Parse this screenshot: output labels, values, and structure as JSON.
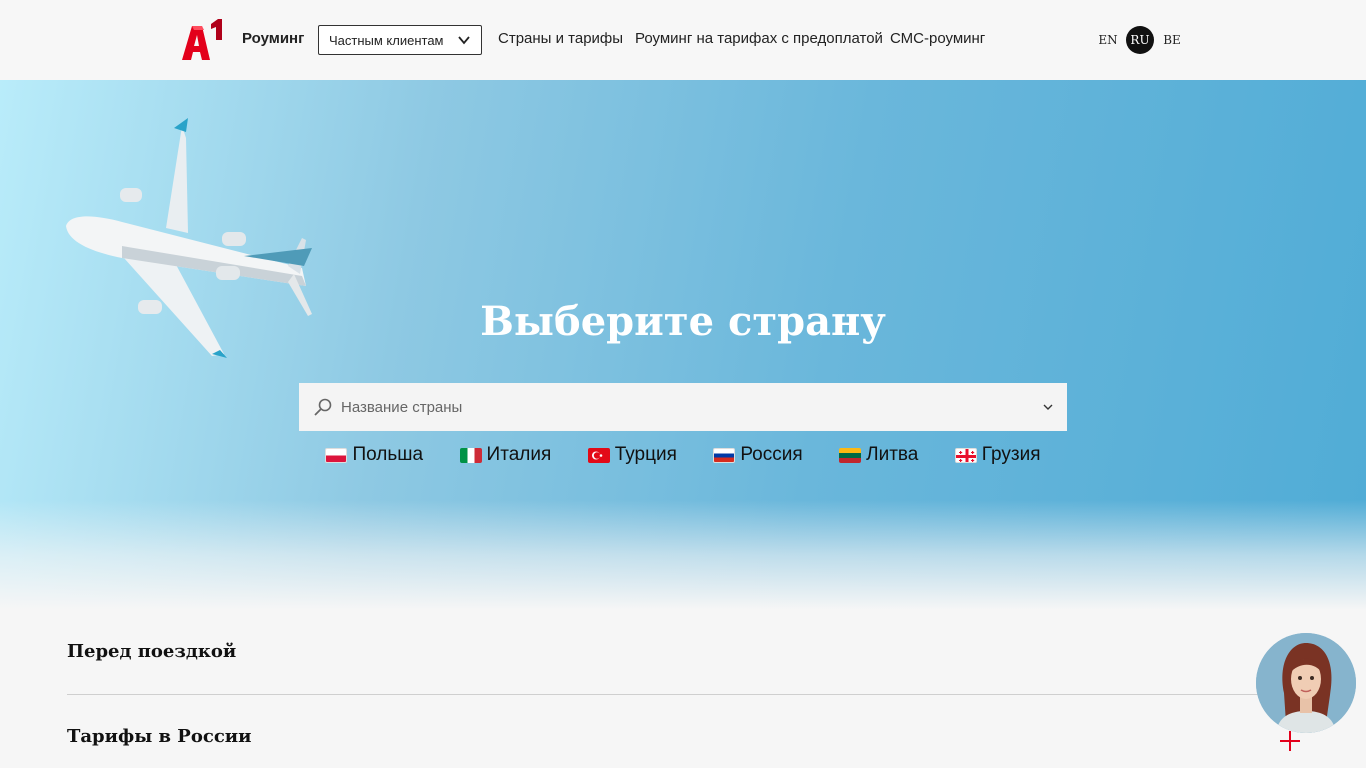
{
  "header": {
    "brand": "Роуминг",
    "segment_select": {
      "value": "Частным клиентам"
    },
    "nav": [
      "Страны и тарифы",
      "Роуминг на тарифах с предоплатой",
      "СМС-роуминг"
    ],
    "languages": [
      "EN",
      "RU",
      "BE"
    ],
    "active_language": "RU"
  },
  "hero": {
    "title": "Выберите страну",
    "search": {
      "placeholder": "Название страны",
      "value": ""
    },
    "countries": [
      {
        "name": "Польша",
        "flag": "flag-poland"
      },
      {
        "name": "Италия",
        "flag": "flag-italy"
      },
      {
        "name": "Турция",
        "flag": "flag-turkey"
      },
      {
        "name": "Россия",
        "flag": "flag-russia"
      },
      {
        "name": "Литва",
        "flag": "flag-lithuania"
      },
      {
        "name": "Грузия",
        "flag": "flag-georgia"
      }
    ]
  },
  "accordion": [
    "Перед поездкой",
    "Тарифы в России"
  ],
  "colors": {
    "brand_red": "#e3001b",
    "hero_light": "#b9ecfa",
    "hero_dark": "#50acd6"
  },
  "icons": [
    "a1-logo",
    "chevron-down-icon",
    "search-icon",
    "plus-icon",
    "assistant-avatar"
  ]
}
